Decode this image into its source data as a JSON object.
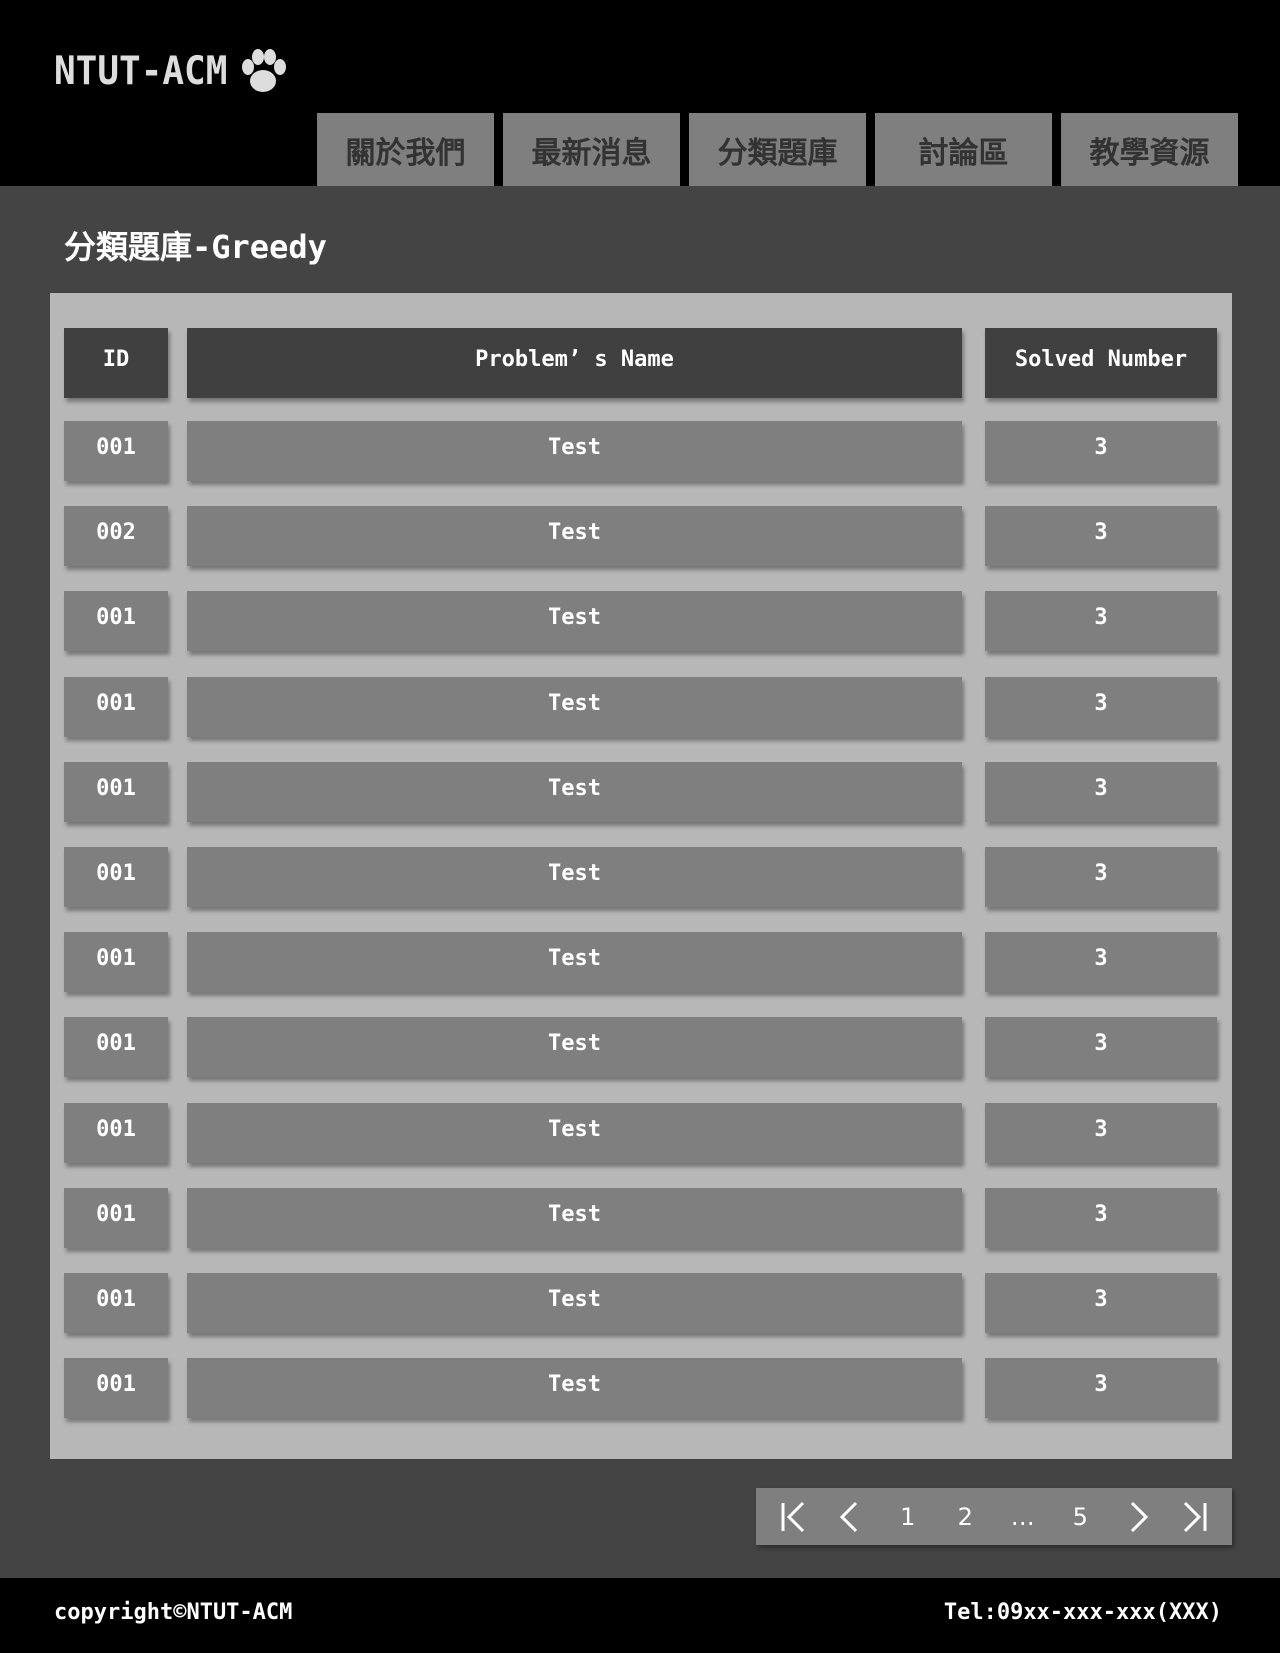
{
  "header": {
    "logo_text": "NTUT-ACM",
    "nav": [
      {
        "label": "關於我們"
      },
      {
        "label": "最新消息"
      },
      {
        "label": "分類題庫"
      },
      {
        "label": "討論區"
      },
      {
        "label": "教學資源"
      }
    ]
  },
  "main": {
    "title": "分類題庫-Greedy",
    "table": {
      "columns": [
        "ID",
        "Problem’ s Name",
        "Solved Number"
      ],
      "rows": [
        {
          "id": "001",
          "name": "Test",
          "solved": "3"
        },
        {
          "id": "002",
          "name": "Test",
          "solved": "3"
        },
        {
          "id": "001",
          "name": "Test",
          "solved": "3"
        },
        {
          "id": "001",
          "name": "Test",
          "solved": "3"
        },
        {
          "id": "001",
          "name": "Test",
          "solved": "3"
        },
        {
          "id": "001",
          "name": "Test",
          "solved": "3"
        },
        {
          "id": "001",
          "name": "Test",
          "solved": "3"
        },
        {
          "id": "001",
          "name": "Test",
          "solved": "3"
        },
        {
          "id": "001",
          "name": "Test",
          "solved": "3"
        },
        {
          "id": "001",
          "name": "Test",
          "solved": "3"
        },
        {
          "id": "001",
          "name": "Test",
          "solved": "3"
        },
        {
          "id": "001",
          "name": "Test",
          "solved": "3"
        }
      ]
    },
    "pagination": {
      "pages": [
        "1",
        "2",
        "…",
        "5"
      ]
    }
  },
  "footer": {
    "copyright": "copyright©NTUT-ACM",
    "tel": "Tel:09xx-xxx-xxx(XXX)"
  }
}
